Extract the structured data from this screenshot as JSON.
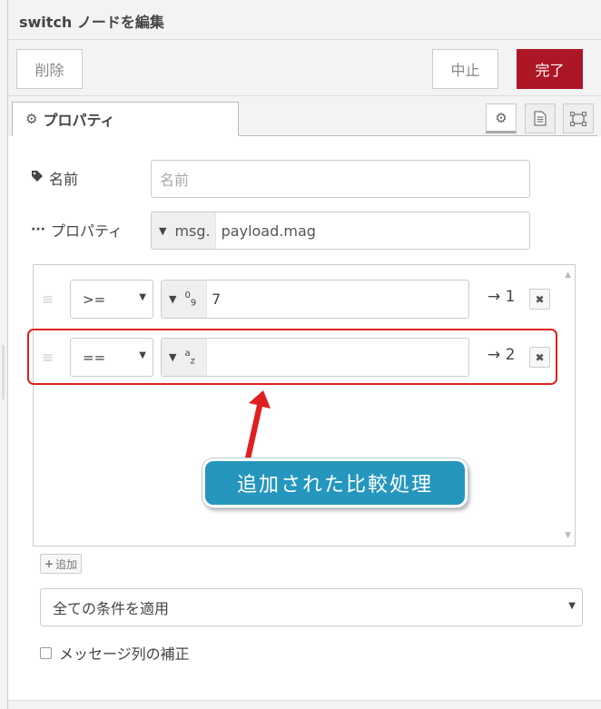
{
  "dialog": {
    "title": "switch ノードを編集",
    "delete_label": "削除",
    "cancel_label": "中止",
    "done_label": "完了"
  },
  "tabs": {
    "properties_label": "プロパティ",
    "icons": [
      "gear-icon",
      "document-icon",
      "layout-icon"
    ]
  },
  "form": {
    "name_label": "名前",
    "name_placeholder": "名前",
    "name_value": "",
    "property_label": "プロパティ",
    "property_type": "msg.",
    "property_value": "payload.mag"
  },
  "rules": [
    {
      "operator": "&gt;=",
      "value_type_glyph": "09",
      "value": "7",
      "output": "→ 1"
    },
    {
      "operator": "==",
      "value_type_glyph": "az",
      "value": "",
      "output": "→ 2"
    }
  ],
  "rules_display": [
    {
      "operator": ">=",
      "output": "→ 1",
      "value": "7"
    },
    {
      "operator": "==",
      "output": "→ 2",
      "value": ""
    }
  ],
  "add_label": "追加",
  "mode_select": {
    "selected": "全ての条件を適用"
  },
  "checkbox": {
    "label": "メッセージ列の補正",
    "checked": false
  },
  "annotation": {
    "callout_text": "追加された比較処理",
    "highlight_color": "#e02020",
    "callout_color": "#2596be"
  },
  "colors": {
    "done_button": "#ad1625"
  }
}
